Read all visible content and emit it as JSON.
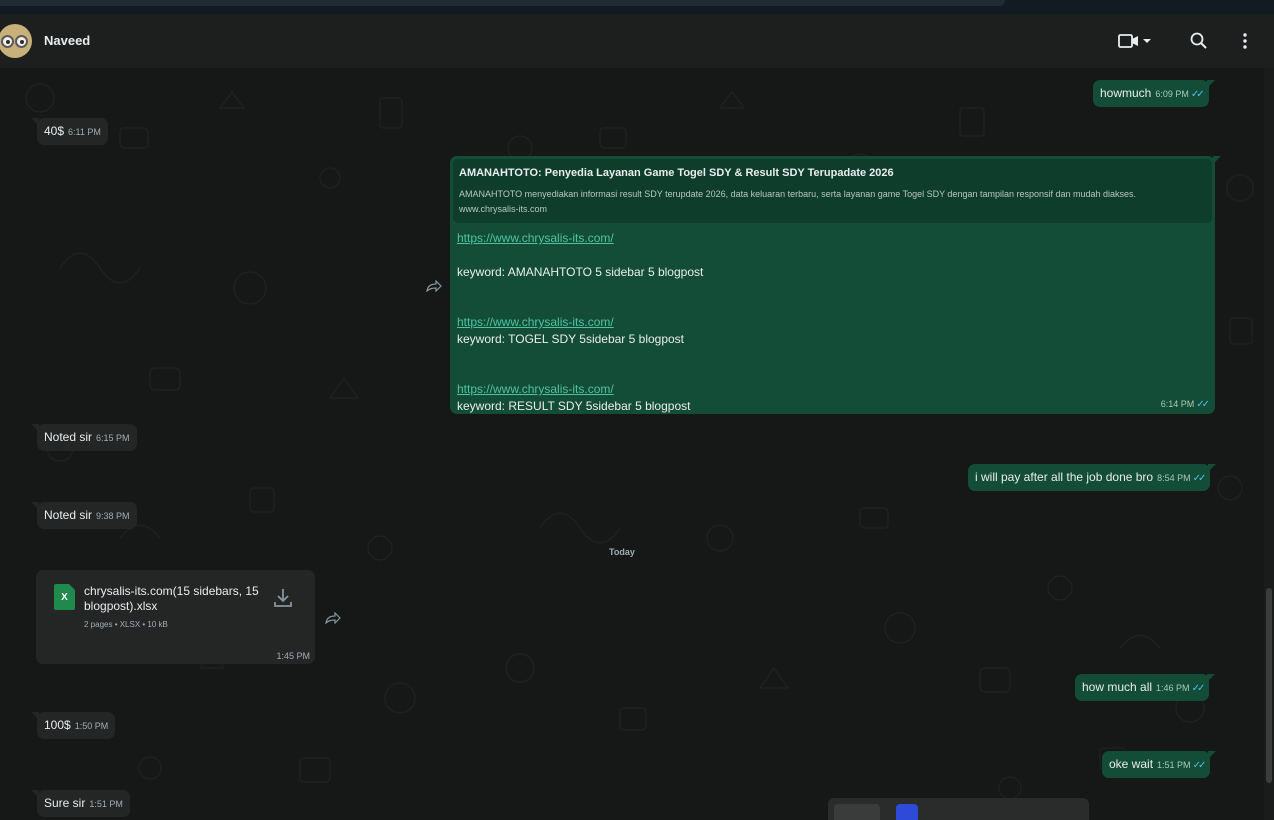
{
  "header": {
    "contact_name": "Naveed"
  },
  "messages": {
    "m1": {
      "text": "howmuch",
      "time": "6:09 PM"
    },
    "m2": {
      "text": "40$",
      "time": "6:11 PM"
    },
    "m3": {
      "preview_title": "AMANAHTOTO: Penyedia Layanan Game Togel SDY & Result SDY Terupadate 2026",
      "preview_desc": "AMANAHTOTO menyediakan informasi result SDY terupdate 2026, data keluaran terbaru, serta layanan game Togel SDY dengan tampilan responsif dan mudah diakses.",
      "preview_url": "www.chrysalis-its.com",
      "link1": "https://www.chrysalis-its.com/",
      "kw1": "keyword: AMANAHTOTO 5 sidebar 5 blogpost",
      "link2": "https://www.chrysalis-its.com/",
      "kw2": "keyword: TOGEL SDY 5sidebar 5 blogpost",
      "link3": "https://www.chrysalis-its.com/",
      "kw3": "keyword: RESULT SDY 5sidebar 5 blogpost",
      "time": "6:14 PM"
    },
    "m4": {
      "text": "Noted sir",
      "time": "6:15 PM"
    },
    "m5": {
      "text": "i will pay after all the job done bro",
      "time": "8:54 PM"
    },
    "m6": {
      "text": "Noted sir",
      "time": "9:38 PM"
    },
    "date_divider": "Today",
    "m7": {
      "file_icon_letter": "X",
      "file_name": "chrysalis-its.com(15 sidebars, 15 blogpost).xlsx",
      "file_meta": "2 pages • XLSX • 10 kB",
      "time": "1:45 PM"
    },
    "m8": {
      "text": "how much all",
      "time": "1:46 PM"
    },
    "m9": {
      "text": "100$",
      "time": "1:50 PM"
    },
    "m10": {
      "text": "oke wait",
      "time": "1:51 PM"
    },
    "m11": {
      "text": "Sure sir",
      "time": "1:51 PM"
    }
  },
  "icons": {
    "video": "video-camera-icon",
    "dropdown": "chevron-down-icon",
    "search": "search-icon",
    "menu": "more-vertical-icon",
    "forward": "forward-icon",
    "download": "download-icon",
    "read_receipt": "double-check-icon"
  },
  "colors": {
    "incoming_bubble": "#242626",
    "outgoing_bubble": "#144d37",
    "link": "#4fc3a1",
    "read_ticks": "#53bdeb"
  }
}
